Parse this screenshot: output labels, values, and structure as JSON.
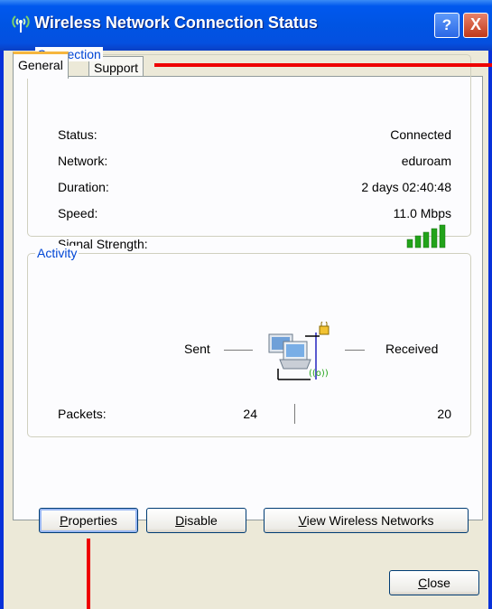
{
  "window": {
    "title": "Wireless Network Connection Status",
    "help_symbol": "?",
    "close_symbol": "X"
  },
  "tabs": [
    {
      "label": "General",
      "selected": true
    },
    {
      "label": "Support",
      "selected": false
    }
  ],
  "connection": {
    "legend": "Connection",
    "rows": [
      {
        "label": "Status:",
        "value": "Connected"
      },
      {
        "label": "Network:",
        "value": "eduroam"
      },
      {
        "label": "Duration:",
        "value": "2 days 02:40:48"
      },
      {
        "label": "Speed:",
        "value": "11.0 Mbps"
      }
    ],
    "signal_label": "Signal Strength:",
    "signal_bars_lit": 5,
    "signal_bars_total": 5
  },
  "activity": {
    "legend": "Activity",
    "sent_label": "Sent",
    "received_label": "Received",
    "packets_label": "Packets:",
    "sent_packets": "24",
    "received_packets": "20"
  },
  "buttons": {
    "properties": {
      "mnemonic": "P",
      "rest": "roperties"
    },
    "disable": {
      "mnemonic": "D",
      "rest": "isable"
    },
    "view_networks": {
      "mnemonic": "V",
      "rest": "iew Wireless Networks"
    },
    "close": {
      "mnemonic": "C",
      "rest": "lose"
    }
  },
  "colors": {
    "title_blue": "#0054e3",
    "group_legend": "#0046d5",
    "annotation_red": "#ee0000",
    "signal_green": "#22a31a"
  }
}
